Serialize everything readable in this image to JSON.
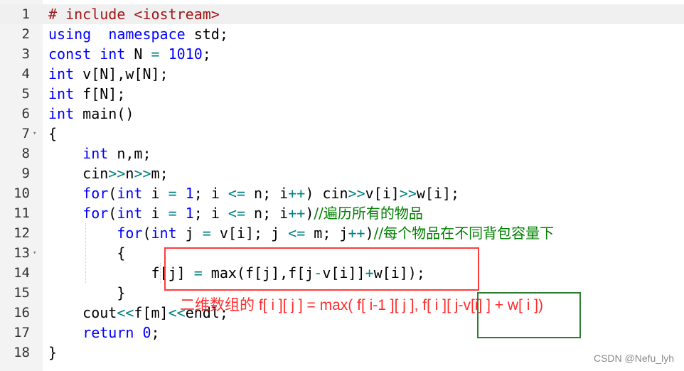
{
  "editor": {
    "lines": [
      {
        "no": "1",
        "fold": "",
        "tokens": [
          [
            "str",
            "# include <iostream>"
          ]
        ]
      },
      {
        "no": "2",
        "fold": "",
        "tokens": [
          [
            "kw",
            "using"
          ],
          [
            "",
            "  "
          ],
          [
            "ns",
            "namespace"
          ],
          [
            "",
            " std;"
          ]
        ]
      },
      {
        "no": "3",
        "fold": "",
        "tokens": [
          [
            "kw",
            "const"
          ],
          [
            "",
            " "
          ],
          [
            "ty",
            "int"
          ],
          [
            "",
            " N "
          ],
          [
            "op",
            "="
          ],
          [
            "",
            " "
          ],
          [
            "num",
            "1010"
          ],
          [
            "",
            ";"
          ]
        ]
      },
      {
        "no": "4",
        "fold": "",
        "tokens": [
          [
            "ty",
            "int"
          ],
          [
            "",
            " v[N],w[N];"
          ]
        ]
      },
      {
        "no": "5",
        "fold": "",
        "tokens": [
          [
            "ty",
            "int"
          ],
          [
            "",
            " f[N];"
          ]
        ]
      },
      {
        "no": "6",
        "fold": "",
        "tokens": [
          [
            "ty",
            "int"
          ],
          [
            "",
            " main()"
          ]
        ]
      },
      {
        "no": "7",
        "fold": "▾",
        "tokens": [
          [
            "",
            "{"
          ]
        ]
      },
      {
        "no": "8",
        "fold": "",
        "tokens": [
          [
            "",
            "    "
          ],
          [
            "ty",
            "int"
          ],
          [
            "",
            " n,m;"
          ]
        ]
      },
      {
        "no": "9",
        "fold": "",
        "tokens": [
          [
            "",
            "    cin"
          ],
          [
            "op",
            ">>"
          ],
          [
            "",
            "n"
          ],
          [
            "op",
            ">>"
          ],
          [
            "",
            "m;"
          ]
        ]
      },
      {
        "no": "10",
        "fold": "",
        "tokens": [
          [
            "",
            "    "
          ],
          [
            "kw",
            "for"
          ],
          [
            "",
            "("
          ],
          [
            "ty",
            "int"
          ],
          [
            "",
            " i "
          ],
          [
            "op",
            "="
          ],
          [
            "",
            " "
          ],
          [
            "num",
            "1"
          ],
          [
            "",
            "; i "
          ],
          [
            "op",
            "<="
          ],
          [
            "",
            " n; i"
          ],
          [
            "op",
            "++"
          ],
          [
            "",
            ") cin"
          ],
          [
            "op",
            ">>"
          ],
          [
            "",
            "v[i]"
          ],
          [
            "op",
            ">>"
          ],
          [
            "",
            "w[i];"
          ]
        ]
      },
      {
        "no": "11",
        "fold": "",
        "tokens": [
          [
            "",
            "    "
          ],
          [
            "kw",
            "for"
          ],
          [
            "",
            "("
          ],
          [
            "ty",
            "int"
          ],
          [
            "",
            " i "
          ],
          [
            "op",
            "="
          ],
          [
            "",
            " "
          ],
          [
            "num",
            "1"
          ],
          [
            "",
            "; i "
          ],
          [
            "op",
            "<="
          ],
          [
            "",
            " n; i"
          ],
          [
            "op",
            "++"
          ],
          [
            "",
            ")"
          ],
          [
            "cm",
            "//遍历所有的物品"
          ]
        ]
      },
      {
        "no": "12",
        "fold": "",
        "tokens": [
          [
            "",
            "        "
          ],
          [
            "kw",
            "for"
          ],
          [
            "",
            "("
          ],
          [
            "ty",
            "int"
          ],
          [
            "",
            " j "
          ],
          [
            "op",
            "="
          ],
          [
            "",
            " v[i]; j "
          ],
          [
            "op",
            "<="
          ],
          [
            "",
            " m; j"
          ],
          [
            "op",
            "++"
          ],
          [
            "",
            ")"
          ],
          [
            "cm",
            "//每个物品在不同背包容量下"
          ]
        ]
      },
      {
        "no": "13",
        "fold": "▾",
        "tokens": [
          [
            "",
            "        {"
          ]
        ]
      },
      {
        "no": "14",
        "fold": "",
        "tokens": [
          [
            "",
            "            f[j] "
          ],
          [
            "op",
            "="
          ],
          [
            "",
            " max(f[j],f[j"
          ],
          [
            "op",
            "-"
          ],
          [
            "",
            "v[i]]"
          ],
          [
            "op",
            "+"
          ],
          [
            "",
            "w[i]);"
          ]
        ]
      },
      {
        "no": "15",
        "fold": "",
        "tokens": [
          [
            "",
            "        }"
          ]
        ]
      },
      {
        "no": "16",
        "fold": "",
        "tokens": [
          [
            "",
            "    cout"
          ],
          [
            "op",
            "<<"
          ],
          [
            "",
            "f[m]"
          ],
          [
            "op",
            "<<"
          ],
          [
            "",
            "endl;"
          ]
        ]
      },
      {
        "no": "17",
        "fold": "",
        "tokens": [
          [
            "",
            "    "
          ],
          [
            "kw",
            "return"
          ],
          [
            "",
            " "
          ],
          [
            "num",
            "0"
          ],
          [
            "",
            ";"
          ]
        ]
      },
      {
        "no": "18",
        "fold": "",
        "tokens": [
          [
            "",
            "}"
          ]
        ]
      }
    ]
  },
  "annotation": {
    "text": "二维数组的 f[ i ][ j ] = max( f[ i-1 ][ j ], f[ i ][ j-v[i] ] + w[ i ])"
  },
  "watermark": "CSDN @Nefu_lyh",
  "colors": {
    "keyword": "#0000ff",
    "operator": "#008080",
    "string": "#a31515",
    "comment": "#008000",
    "annotation": "#ff2b2b",
    "red_box": "#ff3b3b",
    "green_box": "#2e7d32"
  }
}
